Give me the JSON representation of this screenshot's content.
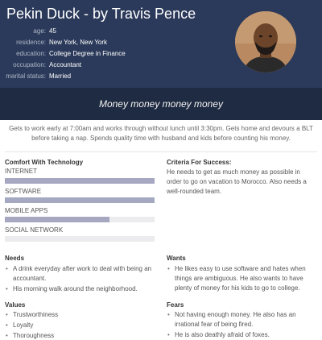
{
  "persona": {
    "name": "Pekin Duck - by Travis Pence",
    "fields": [
      {
        "label": "age:",
        "value": "45"
      },
      {
        "label": "residence:",
        "value": "New York, New York"
      },
      {
        "label": "education:",
        "value": "College Degree in Finance"
      },
      {
        "label": "occupation:",
        "value": "Accountant"
      },
      {
        "label": "marital status:",
        "value": "Married"
      }
    ]
  },
  "quote": "Money money money money",
  "bio": "Gets to work early at 7:00am and works through without lunch until 3:30pm. Gets home and devours a BLT before taking a nap. Spends quality time with husband and kids before counting his money.",
  "technology": {
    "title": "Comfort With Technology",
    "items": [
      {
        "label": "INTERNET",
        "level": 1.0
      },
      {
        "label": "SOFTWARE",
        "level": 1.0
      },
      {
        "label": "MOBILE APPS",
        "level": 0.7
      },
      {
        "label": "SOCIAL NETWORK",
        "level": 0.0
      }
    ]
  },
  "criteria": {
    "title": "Criteria For Success:",
    "text": "He needs to get as much money as possible in order to go on vacation to Morocco. Also needs a well-rounded team."
  },
  "needs": {
    "title": "Needs",
    "items": [
      "A drink everyday after work to deal with being an accountant.",
      "His morning walk around the neighborhood."
    ]
  },
  "wants": {
    "title": "Wants",
    "items": [
      "He likes easy to use software and hates when things are ambiguous. He also wants to have plenty of money for his kids to go to college."
    ]
  },
  "values": {
    "title": "Values",
    "items": [
      "Trustworthiness",
      "Loyalty",
      "Thoroughness"
    ]
  },
  "fears": {
    "title": "Fears",
    "items": [
      "Not having enough money. He also has an irrational fear of being fired.",
      "He is also deathly afraid of foxes."
    ]
  },
  "colors": {
    "header_bg": "#2b3a5a",
    "quote_bg": "#1f2b42",
    "bar_fill": "#a6a8c2",
    "bar_track": "#ececee"
  }
}
